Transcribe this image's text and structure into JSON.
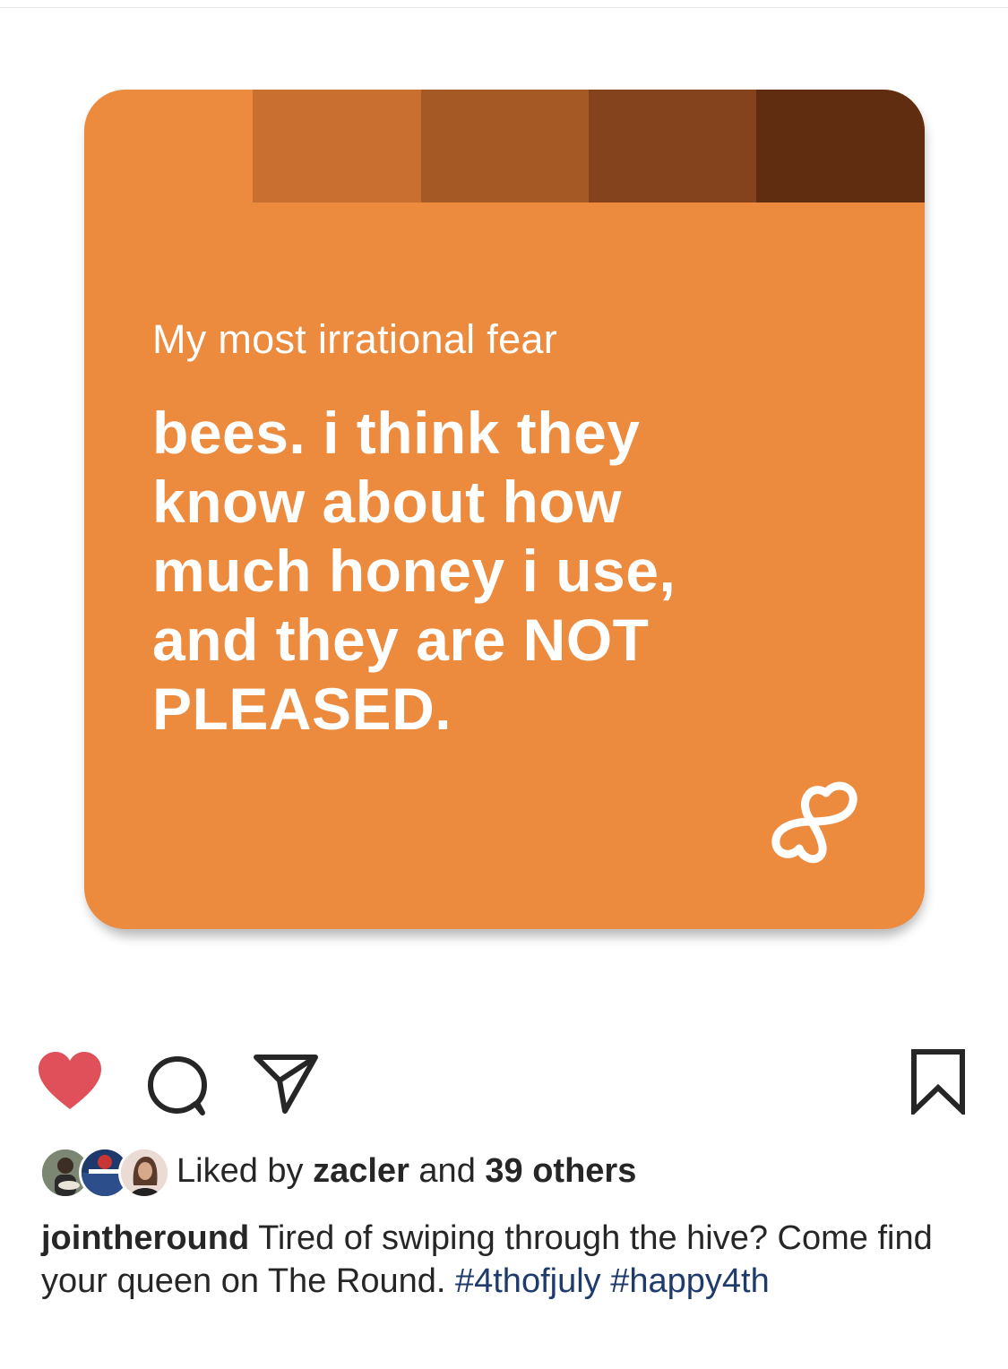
{
  "post": {
    "card": {
      "prompt": "My most irrational fear",
      "answer_lines": [
        "bees. i think they",
        "know about how",
        "much honey i use,",
        "and they are NOT",
        "PLEASED."
      ],
      "colors": {
        "background": "#ec8a3e",
        "swatches": [
          "#c96f30",
          "#a55a26",
          "#84431c",
          "#602d10"
        ]
      },
      "logo_icon": "the-round-logo-icon"
    },
    "actions": {
      "like_icon": "heart-filled-icon",
      "comment_icon": "comment-icon",
      "share_icon": "paper-plane-icon",
      "save_icon": "bookmark-icon",
      "like_color": "#e0505a"
    },
    "likes": {
      "prefix": "Liked by",
      "user": "zacler",
      "middle": "and",
      "others": "39 others"
    },
    "caption": {
      "username": "jointheround",
      "text": "Tired of swiping through the hive? Come find your queen on The Round.",
      "hashtags": [
        "#4thofjuly",
        "#happy4th"
      ]
    }
  }
}
